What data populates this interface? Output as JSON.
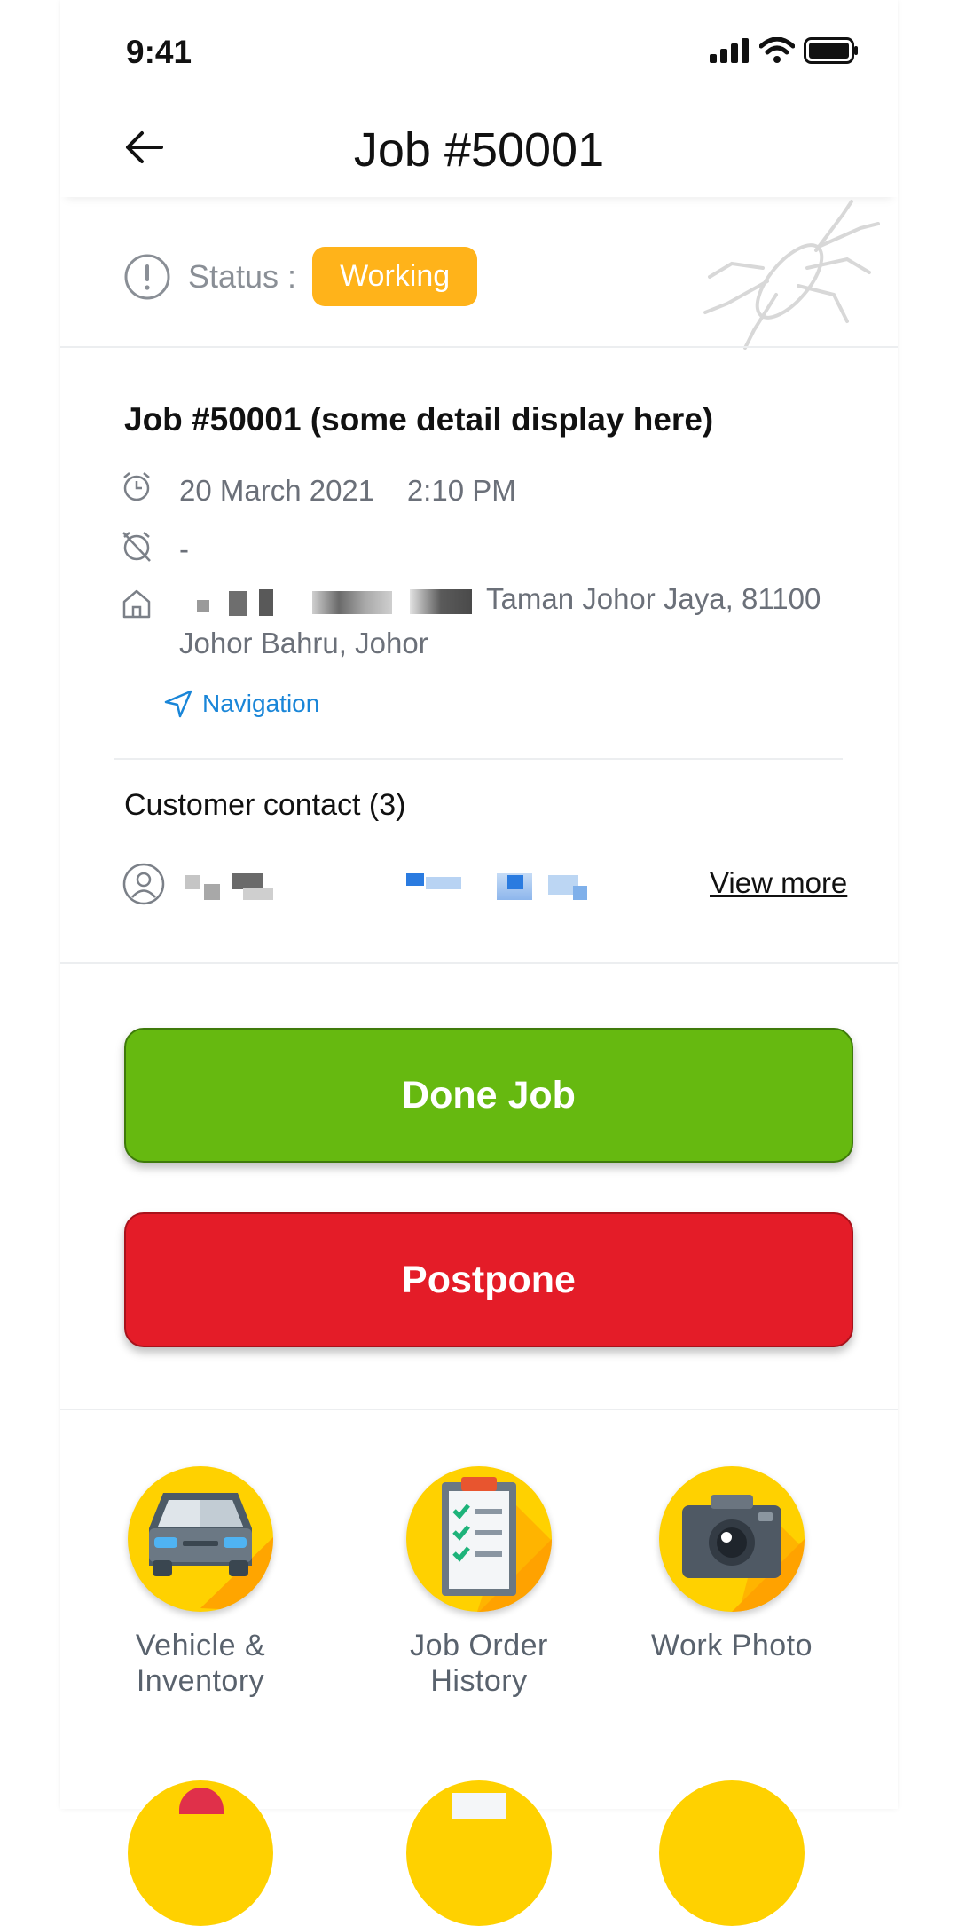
{
  "status_bar": {
    "time": "9:41"
  },
  "header": {
    "title": "Job #50001"
  },
  "status": {
    "label": "Status :",
    "badge": "Working",
    "badge_color": "#ffb31a"
  },
  "job": {
    "title": "Job #50001 (some detail display here)",
    "date": "20 March 2021",
    "time": "2:10 PM",
    "end_time": "-",
    "address_line1": "Taman Johor Jaya, 81100",
    "address_line2": "Johor Bahru, Johor",
    "navigation_label": "Navigation"
  },
  "contact": {
    "title": "Customer contact (3)",
    "view_more": "View more"
  },
  "actions": {
    "done_label": "Done Job",
    "done_color": "#66b910",
    "postpone_label": "Postpone",
    "postpone_color": "#e41c28"
  },
  "tiles": [
    {
      "line1": "Vehicle &",
      "line2": "Inventory",
      "icon": "car-icon"
    },
    {
      "line1": "Job Order",
      "line2": "History",
      "icon": "clipboard-checklist-icon"
    },
    {
      "line1": "Work Photo",
      "line2": "",
      "icon": "camera-icon"
    }
  ]
}
